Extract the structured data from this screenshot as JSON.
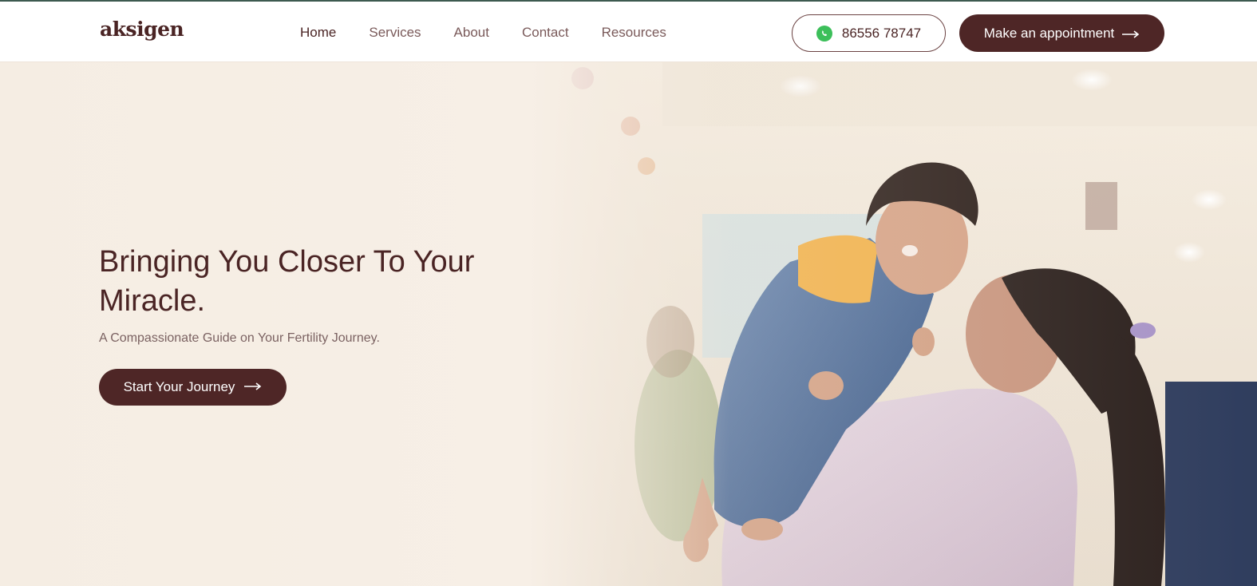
{
  "brand": {
    "logo": "aksigen"
  },
  "nav": {
    "links": [
      {
        "label": "Home",
        "active": true
      },
      {
        "label": "Services"
      },
      {
        "label": "About"
      },
      {
        "label": "Contact"
      },
      {
        "label": "Resources"
      }
    ],
    "phone": {
      "icon": "whatsapp-icon",
      "number": "86556 78747"
    },
    "cta": {
      "label": "Make an appointment",
      "icon": "arrow-right-icon"
    }
  },
  "hero": {
    "title": "Bringing You Closer To Your Miracle.",
    "subtitle": "A Compassionate Guide on Your Fertility Journey.",
    "cta": {
      "label": "Start Your Journey",
      "icon": "arrow-right-icon"
    },
    "image": "mother-lifting-baby-photo"
  },
  "colors": {
    "brand_dark": "#4e2626",
    "text_dark": "#4a2424",
    "whatsapp_green": "#3cbf5a",
    "hero_bg": "#f4ebe0"
  }
}
